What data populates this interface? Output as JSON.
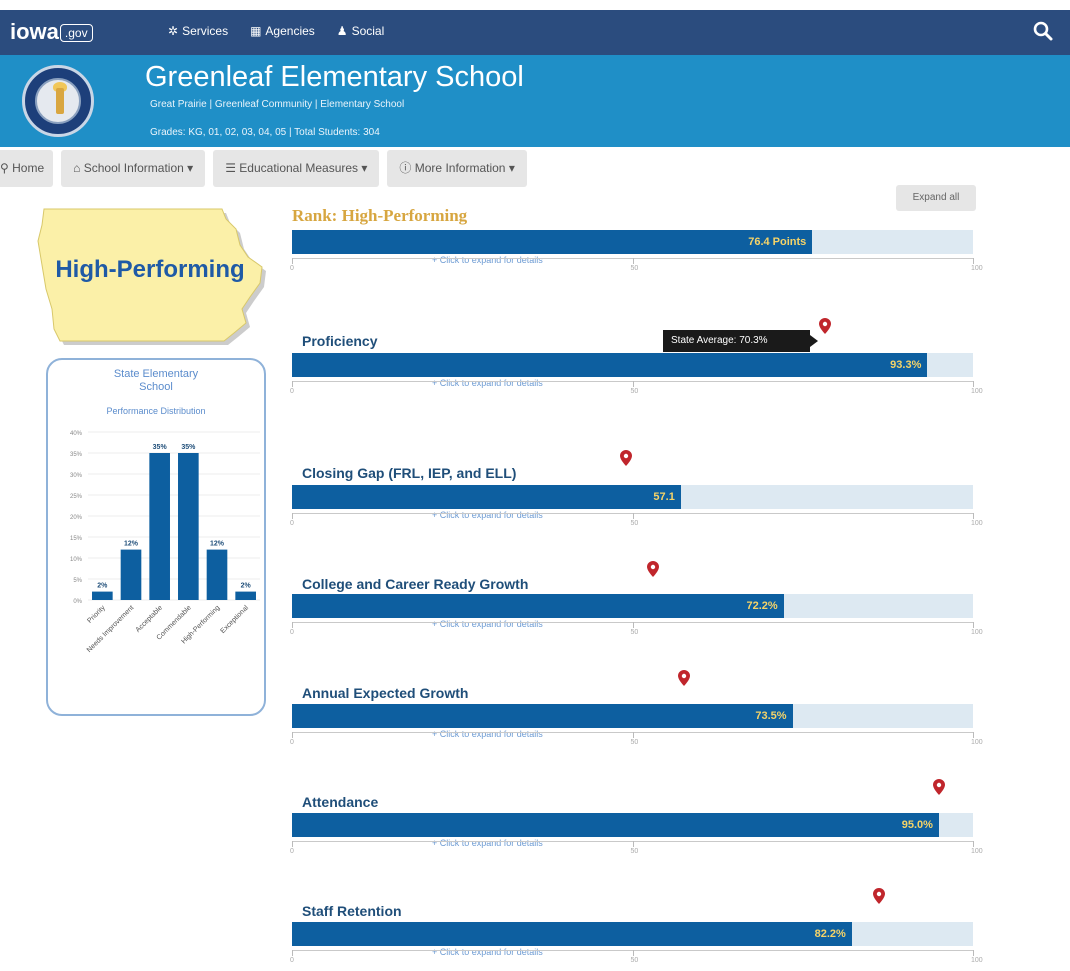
{
  "topbar": {
    "logo_text": "iowa",
    "logo_suffix": ".gov",
    "nav": [
      {
        "icon": "services-icon",
        "label": "Services"
      },
      {
        "icon": "agencies-icon",
        "label": "Agencies"
      },
      {
        "icon": "social-icon",
        "label": "Social"
      }
    ]
  },
  "header": {
    "title": "Greenleaf Elementary School",
    "subtitle": "Great Prairie | Greenleaf Community | Elementary School",
    "grades_line": "Grades: KG, 01, 02, 03, 04, 05 | Total Students: 304"
  },
  "tabs": [
    {
      "label": "Home"
    },
    {
      "label": "School Information"
    },
    {
      "label": "Educational Measures"
    },
    {
      "label": "More Information"
    }
  ],
  "sidebar": {
    "rating_label": "High-Performing",
    "distribution": {
      "title_line1": "State Elementary",
      "title_line2": "School",
      "subtitle": "Performance Distribution"
    }
  },
  "chart_data": {
    "type": "bar",
    "title": "State Elementary School Performance Distribution",
    "categories": [
      "Priority",
      "Needs Improvement",
      "Acceptable",
      "Commendable",
      "High-Performing",
      "Exceptional"
    ],
    "values": [
      2,
      12,
      35,
      35,
      12,
      2
    ],
    "value_labels": [
      "2%",
      "12%",
      "35%",
      "35%",
      "12%",
      "2%"
    ],
    "ylim": [
      0,
      40
    ],
    "yticks": [
      "0%",
      "5%",
      "10%",
      "15%",
      "20%",
      "25%",
      "30%",
      "35%",
      "40%"
    ]
  },
  "main": {
    "expand_all_label": "Expand all",
    "rank_title": "Rank: High-Performing",
    "expand_link_text": "+ Click to expand for details",
    "axis_ticks": [
      "0",
      "50",
      "100"
    ],
    "overall": {
      "value": 76.4,
      "value_label": "76.4 Points"
    },
    "tooltip_text": "State Average: 70.3%",
    "measures": [
      {
        "label": "Proficiency",
        "value": 93.3,
        "value_label": "93.3%",
        "state_avg": 78.3
      },
      {
        "label": "Closing Gap (FRL, IEP, and ELL)",
        "value": 57.1,
        "value_label": "57.1",
        "state_avg": 49.0
      },
      {
        "label": "College and Career Ready Growth",
        "value": 72.2,
        "value_label": "72.2%",
        "state_avg": 53.0
      },
      {
        "label": "Annual Expected Growth",
        "value": 73.5,
        "value_label": "73.5%",
        "state_avg": 57.5
      },
      {
        "label": "Attendance",
        "value": 95.0,
        "value_label": "95.0%",
        "state_avg": 95.0
      },
      {
        "label": "Staff Retention",
        "value": 82.2,
        "value_label": "82.2%",
        "state_avg": 86.2
      }
    ]
  },
  "colors": {
    "topbar": "#2b4c7e",
    "header": "#1f8fc7",
    "bar_fill": "#0d5fa0",
    "bar_track": "#dde9f2",
    "value_text": "#f6d468",
    "rank_gold": "#d7a640",
    "pin": "#c0262c"
  }
}
